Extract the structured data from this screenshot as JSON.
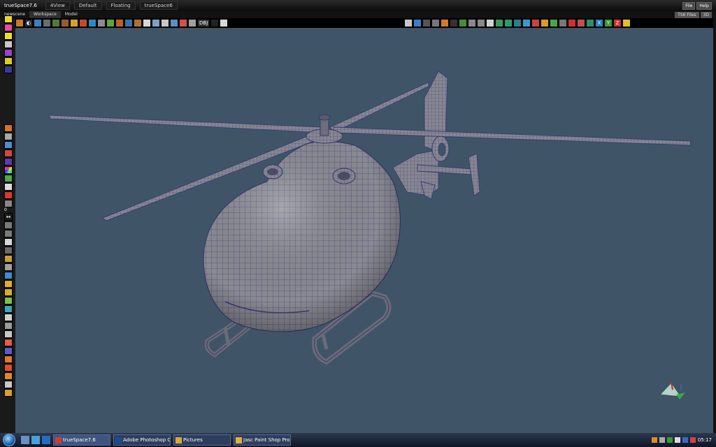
{
  "window": {
    "title": "trueSpace7.6"
  },
  "top_tabs": [
    "4View",
    "Default",
    "Floating",
    "trueSpace6"
  ],
  "top_right_buttons": [
    "File",
    "Help"
  ],
  "scene_tabs": [
    "newscene",
    "Workspace",
    "Model"
  ],
  "active_scene_tab": "Workspace",
  "right_pills": [
    "TS6 Files",
    "3D"
  ],
  "toolbar_text_icons": [
    "DBJ"
  ],
  "ruler_number": "0",
  "taskbar": {
    "items": [
      {
        "label": "trueSpace7.6",
        "active": true
      },
      {
        "label": "Adobe Photoshop C...",
        "active": false
      },
      {
        "label": "Pictures",
        "active": false
      },
      {
        "label": "Jasc Paint Shop Pro ...",
        "active": false
      }
    ],
    "clock": "05:17"
  },
  "colors": {
    "viewport_bg": "#3f5567",
    "mesh_body": "#8a8a92",
    "mesh_wire": "#3d3f7a",
    "taskbar": "#1b2538"
  }
}
